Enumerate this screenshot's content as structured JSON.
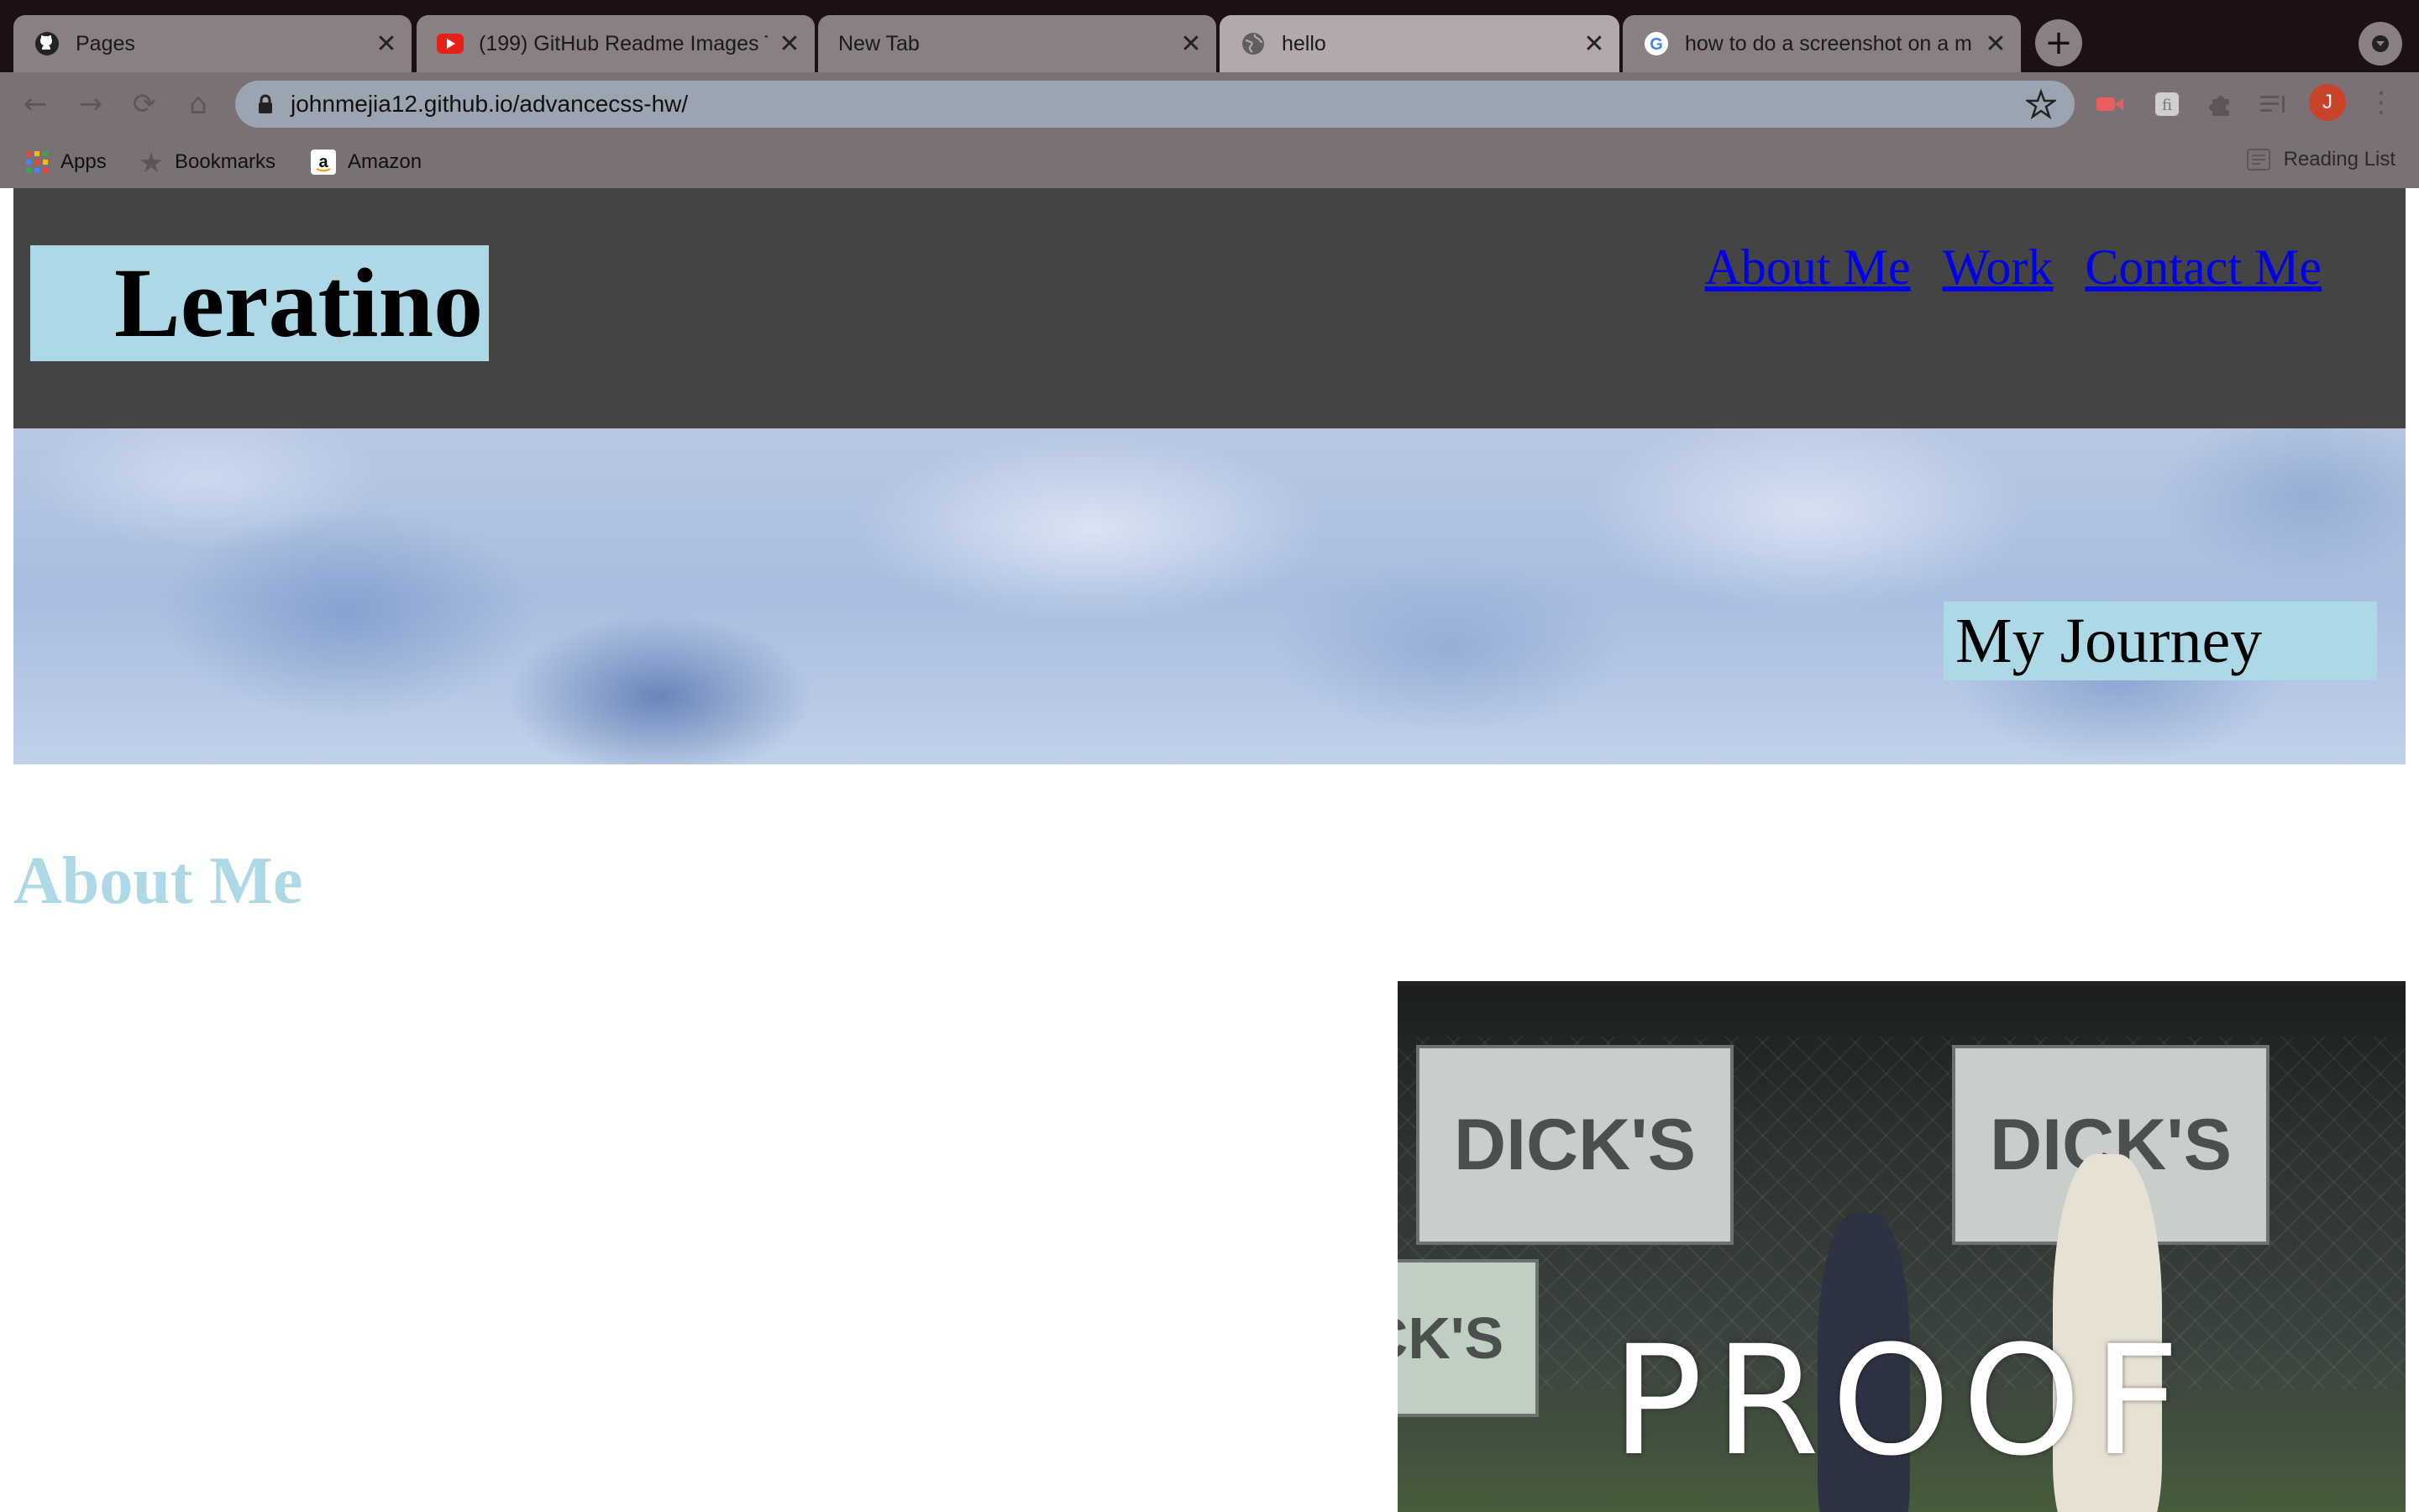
{
  "browser": {
    "tabs": [
      {
        "title": "Pages",
        "icon": "github-icon",
        "active": false
      },
      {
        "title": "(199) GitHub Readme Images T",
        "icon": "youtube-icon",
        "active": false
      },
      {
        "title": "New Tab",
        "icon": "",
        "active": false
      },
      {
        "title": "hello",
        "icon": "globe-icon",
        "active": true
      },
      {
        "title": "how to do a screenshot on a m",
        "icon": "google-icon",
        "active": false
      }
    ],
    "url": "johnmejia12.github.io/advancecss-hw/",
    "profile_initial": "J",
    "bookmarks": [
      {
        "label": "Apps",
        "icon": "apps-grid-icon"
      },
      {
        "label": "Bookmarks",
        "icon": "star-icon"
      },
      {
        "label": "Amazon",
        "icon": "amazon-icon"
      }
    ],
    "reading_list": "Reading List"
  },
  "site": {
    "logo": "Leratino",
    "nav": [
      "About Me",
      "Work",
      "Contact Me"
    ],
    "hero_label": "My Journey",
    "section_heading": "About Me",
    "photo_overlay": "PROOF",
    "photo_banners": [
      "DICK'S",
      "DICK'S",
      "CK'S"
    ]
  },
  "colors": {
    "header_bg": "#444444",
    "label_bg": "#add8e6",
    "link": "#0000ee",
    "heading": "#add8e6"
  }
}
